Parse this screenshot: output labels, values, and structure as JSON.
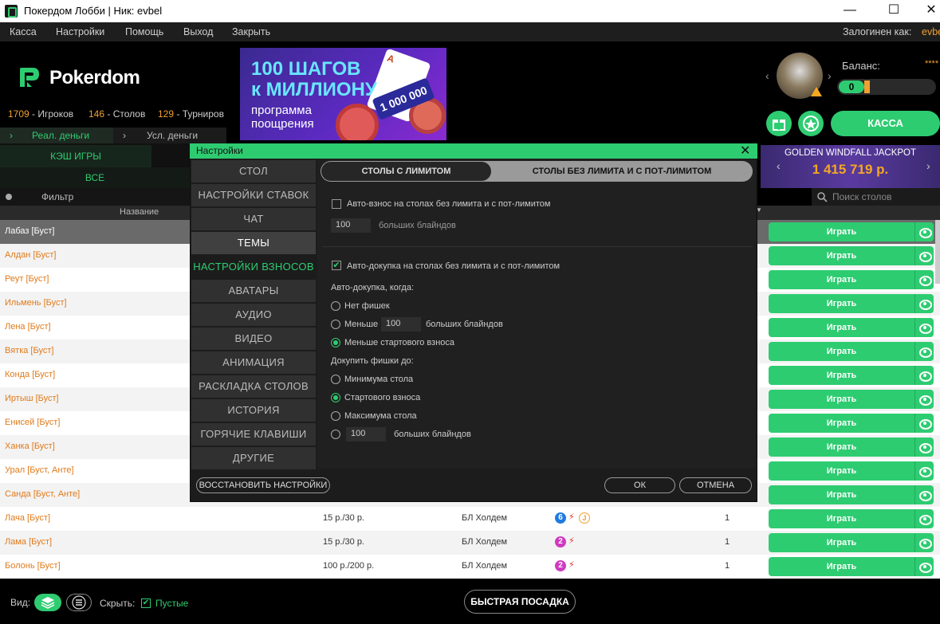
{
  "window": {
    "title": "Покердом Лобби | Ник: evbel",
    "minimize": "—",
    "maximize": "☐",
    "close": "✕"
  },
  "menu": {
    "items": [
      "Касса",
      "Настройки",
      "Помощь",
      "Выход",
      "Закрыть"
    ],
    "logged_in_label": "Залогинен как:",
    "user": "evbe"
  },
  "brand": {
    "name": "Pokerdom",
    "color": "#2ecc71"
  },
  "stats": {
    "players_count": "1709",
    "players_label": "- Игроков",
    "tables_count": "146",
    "tables_label": "- Столов",
    "tournaments_count": "129",
    "tournaments_label": "- Турниров"
  },
  "banner": {
    "line1": "100 ШАГОВ",
    "line2": "к МИЛЛИОНУ",
    "line3": "программа",
    "line4": "поощрения",
    "amount": "1 000 000"
  },
  "account": {
    "balance_label": "Баланс:",
    "balance_hidden": "****",
    "balance_value": "0",
    "cashier_button": "КАССА"
  },
  "money_tabs": {
    "real": "Реал. деньги",
    "play": "Усл. деньги"
  },
  "game_tabs": {
    "cash": "КЭШ ИГРЫ",
    "all": "ВСЕ",
    "filter": "Фильтр",
    "name_column": "Название"
  },
  "jackpot": {
    "title": "GOLDEN WINDFALL JACKPOT",
    "value": "1 415 719 р."
  },
  "search": {
    "placeholder": "Поиск столов"
  },
  "rows": [
    {
      "name": "Лабаз [Буст]",
      "stakes": "",
      "game": "",
      "players": ""
    },
    {
      "name": "Алдан [Буст]",
      "stakes": "",
      "game": "",
      "players": ""
    },
    {
      "name": "Реут [Буст]",
      "stakes": "",
      "game": "",
      "players": ""
    },
    {
      "name": "Ильмень [Буст]",
      "stakes": "",
      "game": "",
      "players": ""
    },
    {
      "name": "Лена [Буст]",
      "stakes": "",
      "game": "",
      "players": ""
    },
    {
      "name": "Вятка [Буст]",
      "stakes": "",
      "game": "",
      "players": ""
    },
    {
      "name": "Конда [Буст]",
      "stakes": "",
      "game": "",
      "players": ""
    },
    {
      "name": "Иртыш [Буст]",
      "stakes": "",
      "game": "",
      "players": ""
    },
    {
      "name": "Енисей [Буст]",
      "stakes": "",
      "game": "",
      "players": ""
    },
    {
      "name": "Ханка [Буст]",
      "stakes": "",
      "game": "",
      "players": ""
    },
    {
      "name": "Урал [Буст, Анте]",
      "stakes": "",
      "game": "",
      "players": ""
    },
    {
      "name": "Санда [Буст, Анте]",
      "stakes": "",
      "game": "",
      "players": ""
    },
    {
      "name": "Лача [Буст]",
      "stakes": "15 р./30 р.",
      "game": "БЛ Холдем",
      "players": "1",
      "badge": "6",
      "badge_color": "#1e7be0",
      "jbadge": "J"
    },
    {
      "name": "Лама [Буст]",
      "stakes": "15 р./30 р.",
      "game": "БЛ Холдем",
      "players": "1",
      "badge": "2",
      "badge_color": "#d03ac0"
    },
    {
      "name": "Болонь [Буст]",
      "stakes": "100 р./200 р.",
      "game": "БЛ Холдем",
      "players": "1",
      "badge": "2",
      "badge_color": "#d03ac0"
    }
  ],
  "play_label": "Играть",
  "footer": {
    "view_label": "Вид:",
    "hide_label": "Скрыть:",
    "empty_label": "Пустые",
    "fast_seat": "БЫСТРАЯ ПОСАДКА"
  },
  "dialog": {
    "title": "Настройки",
    "nav": [
      "СТОЛ",
      "НАСТРОЙКИ СТАВОК",
      "ЧАТ",
      "ТЕМЫ",
      "НАСТРОЙКИ ВЗНОСОВ",
      "АВАТАРЫ",
      "АУДИО",
      "ВИДЕО",
      "АНИМАЦИЯ",
      "РАСКЛАДКА СТОЛОВ",
      "ИСТОРИЯ",
      "ГОРЯЧИЕ КЛАВИШИ",
      "ДРУГИЕ"
    ],
    "tab_limit": "СТОЛЫ С ЛИМИТОМ",
    "tab_nolimit": "СТОЛЫ БЕЗ ЛИМИТА И С ПОТ-ЛИМИТОМ",
    "auto_buyin_label": "Авто-взнос на столах без лимита и с пот-лимитом",
    "auto_buyin_value": "100",
    "big_blinds": "больших блайндов",
    "auto_rebuy_label": "Авто-докупка на столах без лимита и с пот-лимитом",
    "auto_rebuy_when": "Авто-докупка, когда:",
    "opt_no_chips": "Нет фишек",
    "opt_less": "Меньше",
    "opt_less_value": "100",
    "opt_less_start": "Меньше стартового взноса",
    "rebuy_to": "Докупить фишки до:",
    "opt_min": "Минимума стола",
    "opt_start": "Стартового взноса",
    "opt_max": "Максимума стола",
    "opt_bb_value": "100",
    "restore": "ВОССТАНОВИТЬ НАСТРОЙКИ",
    "ok": "ОК",
    "cancel": "ОТМЕНА"
  }
}
